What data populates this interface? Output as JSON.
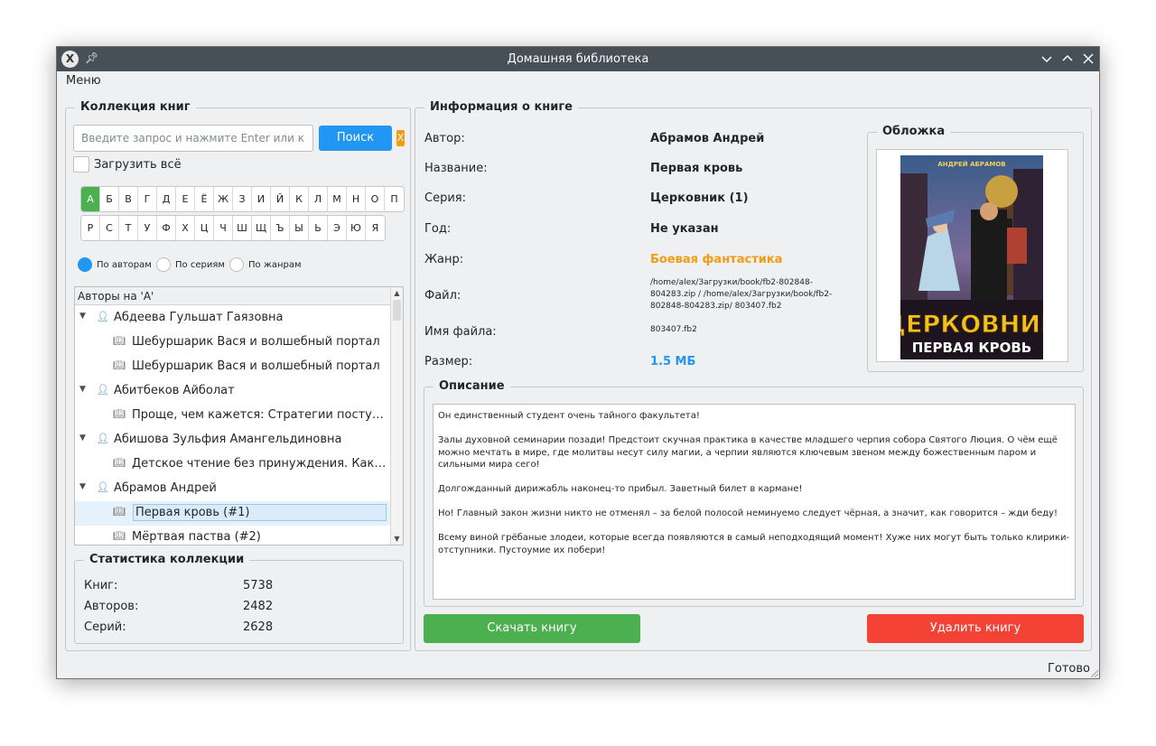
{
  "window": {
    "title": "Домашняя библиотека",
    "menu_label": "Меню",
    "status": "Готово"
  },
  "collection": {
    "title": "Коллекция книг",
    "search_placeholder": "Введите запрос и нажмите Enter или к...",
    "search_label": "Поиск",
    "clear_label": "X",
    "load_all_label": "Загрузить всё",
    "alphabet_row1": [
      "А",
      "Б",
      "В",
      "Г",
      "Д",
      "Е",
      "Ё",
      "Ж",
      "З",
      "И",
      "Й",
      "К",
      "Л",
      "М",
      "Н",
      "О",
      "П"
    ],
    "alphabet_row2": [
      "Р",
      "С",
      "Т",
      "У",
      "Ф",
      "Х",
      "Ц",
      "Ч",
      "Ш",
      "Щ",
      "Ъ",
      "Ы",
      "Ь",
      "Э",
      "Ю",
      "Я"
    ],
    "active_letter": "А",
    "modes": [
      "По авторам",
      "По сериям",
      "По жанрам"
    ],
    "active_mode": "По авторам",
    "tree_header": "Авторы на 'А'",
    "tree": [
      {
        "kind": "author",
        "text": "Абдеева Гульшат Гаязовна"
      },
      {
        "kind": "book",
        "text": "Шебуршарик Вася и волшебный портал"
      },
      {
        "kind": "book",
        "text": "Шебуршарик Вася и волшебный портал"
      },
      {
        "kind": "author",
        "text": "Абитбеков Айболат"
      },
      {
        "kind": "book",
        "text": "Проще, чем кажется: Стратегии поступлени..."
      },
      {
        "kind": "author",
        "text": "Абишова Зульфия Амангельдиновна"
      },
      {
        "kind": "book",
        "text": "Детское чтение без принуждения. Как прив..."
      },
      {
        "kind": "author",
        "text": "Абрамов Андрей"
      },
      {
        "kind": "book",
        "text": "Первая кровь (#1)",
        "selected": true
      },
      {
        "kind": "book",
        "text": "Мёртвая паства (#2)"
      }
    ]
  },
  "stats": {
    "title": "Статистика коллекции",
    "books_label": "Книг:",
    "books_value": "5738",
    "authors_label": "Авторов:",
    "authors_value": "2482",
    "series_label": "Серий:",
    "series_value": "2628"
  },
  "book": {
    "title": "Информация о книге",
    "author_label": "Автор:",
    "author_value": "Абрамов Андрей",
    "name_label": "Название:",
    "name_value": "Первая кровь",
    "series_label": "Серия:",
    "series_value": "Церковник (1)",
    "year_label": "Год:",
    "year_value": "Не указан",
    "genre_label": "Жанр:",
    "genre_value": "Боевая фантастика",
    "file_label": "Файл:",
    "file_value": "/home/alex/Загрузки/book/fb2-802848-804283.zip / /home/alex/Загрузки/book/fb2-802848-804283.zip/ 803407.fb2",
    "filename_label": "Имя файла:",
    "filename_value": "803407.fb2",
    "size_label": "Размер:",
    "size_value": "1.5 МБ",
    "cover_title": "Обложка",
    "cover_author": "АНДРЕЙ АБРАМОВ",
    "cover_series": "ЦЕРКОВНИК",
    "cover_book": "ПЕРВАЯ КРОВЬ"
  },
  "description": {
    "title": "Описание",
    "paragraphs": [
      "Он единственный студент очень тайного факультета!",
      "Залы духовной семинарии позади! Предстоит скучная практика в качестве младшего черпия собора Святого Люция. О чём ещё можно мечтать в мире, где молитвы несут силу магии, а черпии являются ключевым звеном между божественным паром и сильными мира сего!",
      "Долгожданный дирижабль наконец-то прибыл. Заветный билет в кармане!",
      "Но! Главный закон жизни никто не отменял – за белой полосой неминуемо следует чёрная, а значит, как говорится – жди беду!",
      "Всему виной грёбаные злодеи, которые всегда появляются в самый неподходящий момент! Хуже них могут быть только клирики-отступники. Пустоумие их побери!"
    ]
  },
  "actions": {
    "download_label": "Скачать книгу",
    "delete_label": "Удалить книгу"
  },
  "colors": {
    "accent_blue": "#2196f3",
    "success_green": "#4caf50",
    "danger_red": "#f44336",
    "genre_orange": "#f39c12",
    "titlebar": "#475057"
  }
}
